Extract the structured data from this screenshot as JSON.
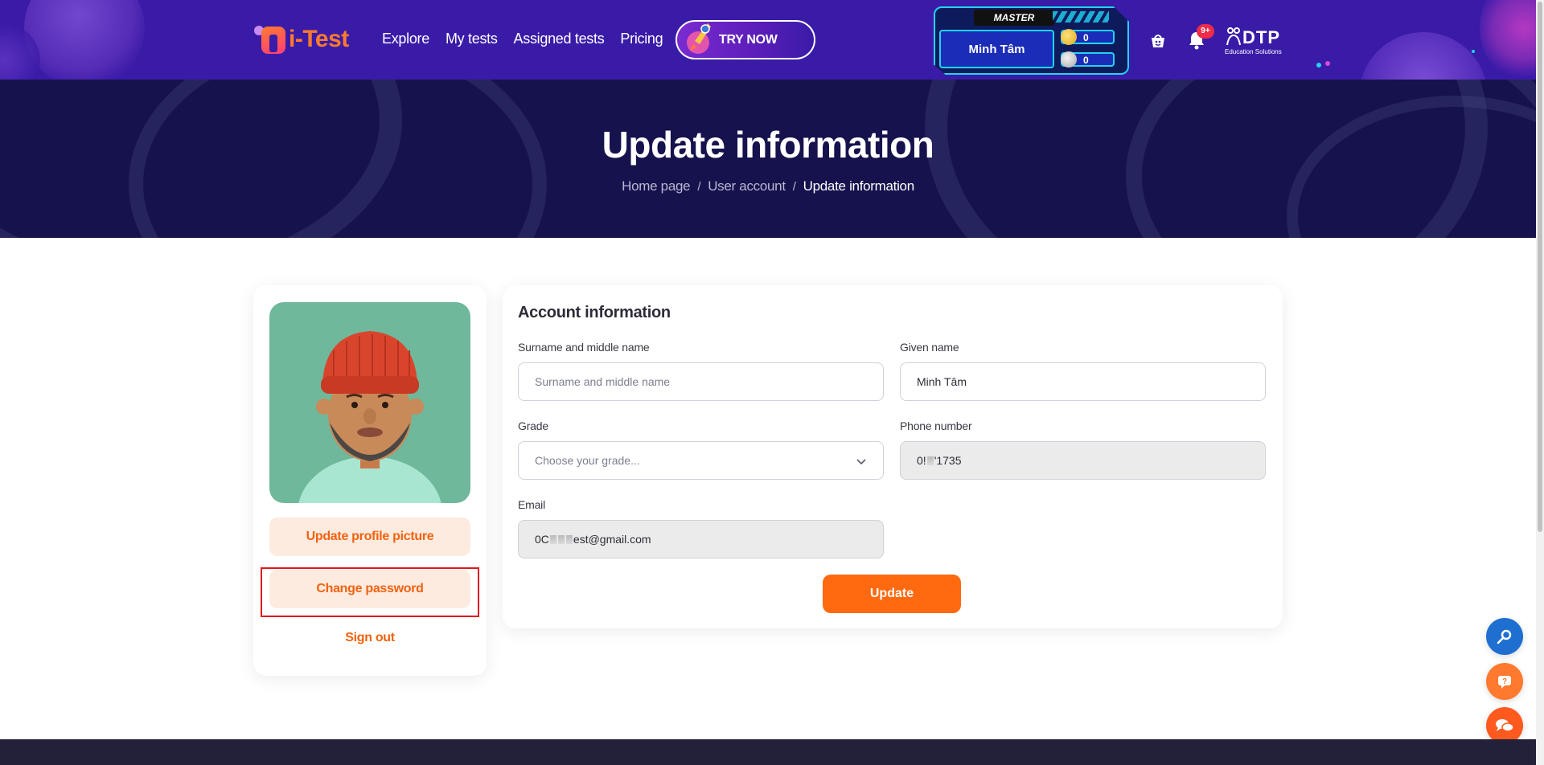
{
  "brand": {
    "logo_text": "i-Test"
  },
  "nav": {
    "items": [
      {
        "label": "Explore"
      },
      {
        "label": "My tests"
      },
      {
        "label": "Assigned tests"
      },
      {
        "label": "Pricing"
      }
    ],
    "try_now_label": "TRY NOW"
  },
  "player": {
    "rank": "MASTER",
    "name": "Minh Tâm",
    "gold_coins": "0",
    "silver_coins": "0"
  },
  "notifications": {
    "badge": "9+"
  },
  "partner": {
    "name": "DTP",
    "tagline": "Education Solutions"
  },
  "hero": {
    "title": "Update information",
    "breadcrumb": [
      {
        "label": "Home page"
      },
      {
        "label": "User account"
      }
    ],
    "breadcrumb_current": "Update information"
  },
  "profile_menu": {
    "update_picture_label": "Update profile picture",
    "change_password_label": "Change password",
    "sign_out_label": "Sign out"
  },
  "account_form": {
    "title": "Account information",
    "surname": {
      "label": "Surname and middle name",
      "placeholder": "Surname and middle name",
      "value": ""
    },
    "given_name": {
      "label": "Given name",
      "value": "Minh Tâm"
    },
    "grade": {
      "label": "Grade",
      "placeholder": "Choose your grade..."
    },
    "phone": {
      "label": "Phone number",
      "prefix": "0!",
      "suffix": "'1735"
    },
    "email": {
      "label": "Email",
      "prefix": "0C",
      "suffix": "est@gmail.com"
    },
    "update_label": "Update"
  },
  "colors": {
    "topbar": "#3a1ba8",
    "hero": "#16124d",
    "accent": "#ff6a10",
    "soft_button": "#fdebe0",
    "highlight": "#e0161e"
  }
}
